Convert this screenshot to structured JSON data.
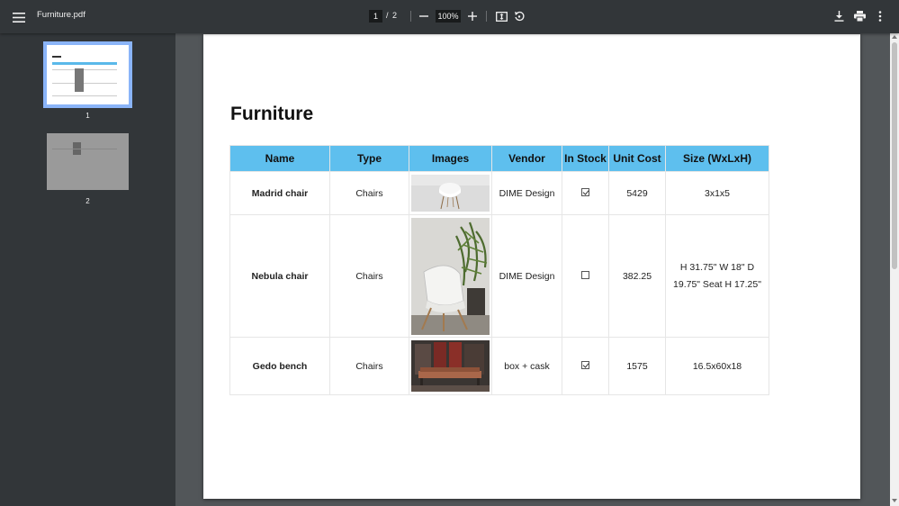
{
  "toolbar": {
    "file_name": "Furniture.pdf",
    "current_page": "1",
    "page_separator": "/",
    "total_pages": "2",
    "zoom": "100%"
  },
  "sidebar": {
    "thumbnails": [
      {
        "label": "1",
        "selected": true
      },
      {
        "label": "2",
        "selected": false
      }
    ]
  },
  "document": {
    "title": "Furniture",
    "columns": [
      "Name",
      "Type",
      "Images",
      "Vendor",
      "In Stock",
      "Unit Cost",
      "Size (WxLxH)"
    ],
    "rows": [
      {
        "name": "Madrid chair",
        "type": "Chairs",
        "image": "white-chair-photo",
        "vendor": "DIME Design",
        "in_stock": true,
        "unit_cost": "5429",
        "size": "3x1x5"
      },
      {
        "name": "Nebula chair",
        "type": "Chairs",
        "image": "white-lounge-chair-with-plant-photo",
        "vendor": "DIME Design",
        "in_stock": false,
        "unit_cost": "382.25",
        "size": "H 31.75\" W 18\" D 19.75\" Seat H 17.25\""
      },
      {
        "name": "Gedo bench",
        "type": "Chairs",
        "image": "bench-in-interior-photo",
        "vendor": "box + cask",
        "in_stock": true,
        "unit_cost": "1575",
        "size": "16.5x60x18"
      }
    ]
  },
  "colors": {
    "toolbar_bg": "#323639",
    "viewer_bg": "#525659",
    "header_accent": "#5ebfee",
    "thumbnail_selected": "#8ab4f8"
  }
}
